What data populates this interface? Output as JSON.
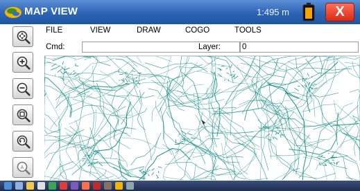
{
  "window": {
    "title": "MAP VIEW",
    "scale": "1:495 m",
    "close_label": "X"
  },
  "menu": {
    "items": [
      {
        "id": "file",
        "label": "FILE"
      },
      {
        "id": "view",
        "label": "VIEW"
      },
      {
        "id": "draw",
        "label": "DRAW"
      },
      {
        "id": "cogo",
        "label": "COGO"
      },
      {
        "id": "tools",
        "label": "TOOLS"
      }
    ]
  },
  "command": {
    "label": "Cmd:",
    "value": "",
    "layer_label": "Layer:",
    "layer_value": "0"
  },
  "toolbar": {
    "tools": [
      {
        "name": "pan-tool-button",
        "icon": "pan-magnifier-icon"
      },
      {
        "name": "zoom-in-button",
        "icon": "zoom-in-icon"
      },
      {
        "name": "zoom-out-button",
        "icon": "zoom-out-icon"
      },
      {
        "name": "zoom-window-button",
        "icon": "zoom-window-icon"
      },
      {
        "name": "zoom-previous-button",
        "icon": "zoom-previous-icon"
      },
      {
        "name": "zoom-extents-button",
        "icon": "zoom-extents-icon"
      }
    ]
  },
  "colors": {
    "title_bar": "#2c63b3",
    "map_lines": "#1a8f8a",
    "close_button": "#d92a14",
    "battery": "#f5a300"
  }
}
